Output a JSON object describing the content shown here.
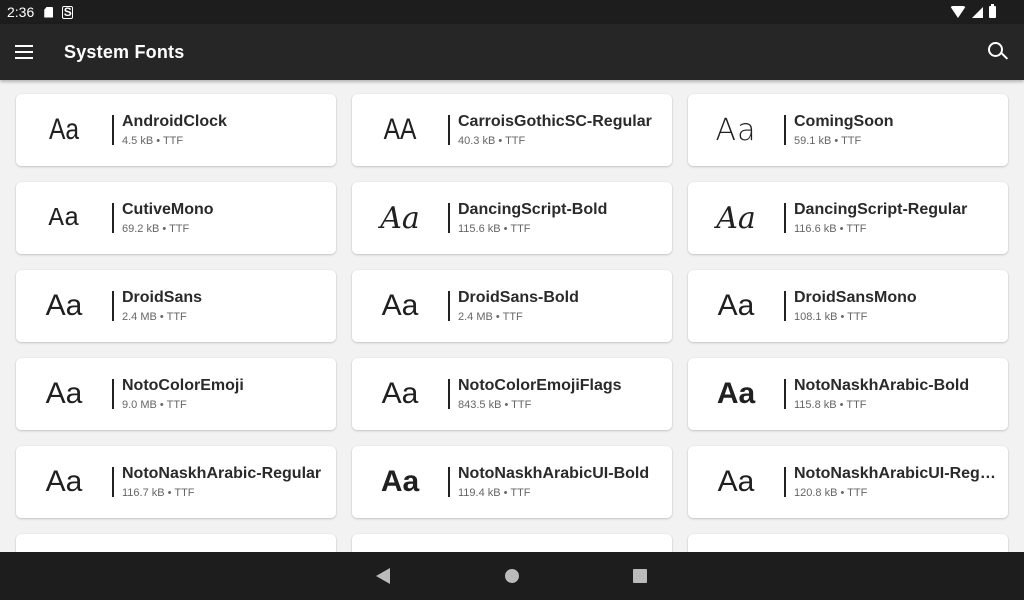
{
  "status_bar": {
    "time": "2:36",
    "icons_left": [
      "sd-card-icon",
      "s-icon"
    ],
    "icons_right": [
      "wifi-icon",
      "signal-icon",
      "battery-icon"
    ]
  },
  "app_bar": {
    "title": "System Fonts",
    "menu_icon": "menu-icon",
    "search_icon": "search-icon"
  },
  "fonts": [
    {
      "sample": "Aa",
      "name": "AndroidClock",
      "meta": "4.5 kB • TTF",
      "style": "narrow"
    },
    {
      "sample": "AA",
      "name": "CarroisGothicSC-Regular",
      "meta": "40.3 kB • TTF",
      "style": "narrow"
    },
    {
      "sample": "Aa",
      "name": "ComingSoon",
      "meta": "59.1 kB • TTF",
      "style": "hand"
    },
    {
      "sample": "Aa",
      "name": "CutiveMono",
      "meta": "69.2 kB • TTF",
      "style": "mono"
    },
    {
      "sample": "Aa",
      "name": "DancingScript-Bold",
      "meta": "115.6 kB • TTF",
      "style": "script"
    },
    {
      "sample": "Aa",
      "name": "DancingScript-Regular",
      "meta": "116.6 kB • TTF",
      "style": "script"
    },
    {
      "sample": "Aa",
      "name": "DroidSans",
      "meta": "2.4 MB • TTF",
      "style": "normal"
    },
    {
      "sample": "Aa",
      "name": "DroidSans-Bold",
      "meta": "2.4 MB • TTF",
      "style": "normal"
    },
    {
      "sample": "Aa",
      "name": "DroidSansMono",
      "meta": "108.1 kB • TTF",
      "style": "normal"
    },
    {
      "sample": "Aa",
      "name": "NotoColorEmoji",
      "meta": "9.0 MB • TTF",
      "style": "normal"
    },
    {
      "sample": "Aa",
      "name": "NotoColorEmojiFlags",
      "meta": "843.5 kB • TTF",
      "style": "normal"
    },
    {
      "sample": "Aa",
      "name": "NotoNaskhArabic-Bold",
      "meta": "115.8 kB • TTF",
      "style": "bold"
    },
    {
      "sample": "Aa",
      "name": "NotoNaskhArabic-Regular",
      "meta": "116.7 kB • TTF",
      "style": "normal"
    },
    {
      "sample": "Aa",
      "name": "NotoNaskhArabicUI-Bold",
      "meta": "119.4 kB • TTF",
      "style": "bold"
    },
    {
      "sample": "Aa",
      "name": "NotoNaskhArabicUI-Regular",
      "meta": "120.8 kB • TTF",
      "style": "normal"
    },
    {
      "sample": "",
      "name": "",
      "meta": "",
      "style": "normal"
    },
    {
      "sample": "",
      "name": "",
      "meta": "",
      "style": "normal"
    },
    {
      "sample": "",
      "name": "",
      "meta": "",
      "style": "normal"
    }
  ],
  "nav_bar": {
    "back_icon": "back-icon",
    "home_icon": "home-icon",
    "recents_icon": "recents-icon"
  },
  "colors": {
    "status_bar": "#1d1d1d",
    "app_bar": "#262626",
    "background": "#f2f2f2",
    "card": "#ffffff"
  }
}
